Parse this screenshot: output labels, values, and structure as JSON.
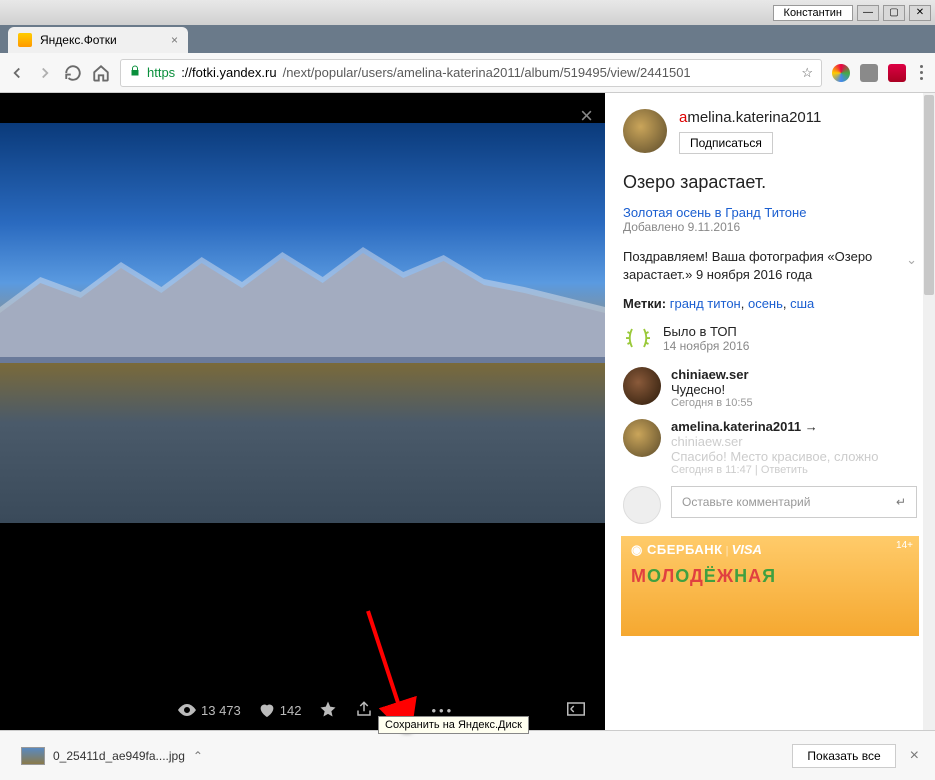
{
  "window": {
    "user": "Константин"
  },
  "tab": {
    "title": "Яндекс.Фотки"
  },
  "address": {
    "proto": "https",
    "host": "://fotki.yandex.ru",
    "path": "/next/popular/users/amelina-katerina2011/album/519495/view/2441501"
  },
  "viewer": {
    "views": "13 473",
    "likes": "142",
    "tooltip": "Сохранить на Яндекс.Диск"
  },
  "side": {
    "username_prefix": "a",
    "username_rest": "melina.katerina2011",
    "subscribe": "Подписаться",
    "title": "Озеро зарастает.",
    "album": "Золотая осень в Гранд Титоне",
    "added": "Добавлено 9.11.2016",
    "congrats": "Поздравляем! Ваша фотография «Озеро зарастает.» 9 ноября 2016 года",
    "tags_label": "Метки:",
    "tags": [
      "гранд титон",
      "осень",
      "сша"
    ],
    "top_label": "Было в ТОП",
    "top_date": "14 ноября 2016",
    "comments": [
      {
        "name": "chiniaew.ser",
        "text": "Чудесно!",
        "time": "Сегодня в 10:55"
      },
      {
        "name": "amelina.katerina2011",
        "reply_to": "chiniaew.ser",
        "text": "Спасибо! Место красивое, сложно",
        "time": "Сегодня в 11:47",
        "reply": "Ответить"
      }
    ],
    "reply_placeholder": "Оставьте комментарий",
    "ad": {
      "brand": "СБЕРБАНК",
      "visa": "VISA",
      "age": "14+",
      "big": "МОЛОДЁЖНАЯ КАРТА"
    }
  },
  "downloads": {
    "file": "0_25411d_ae949fa....jpg",
    "show_all": "Показать все"
  }
}
